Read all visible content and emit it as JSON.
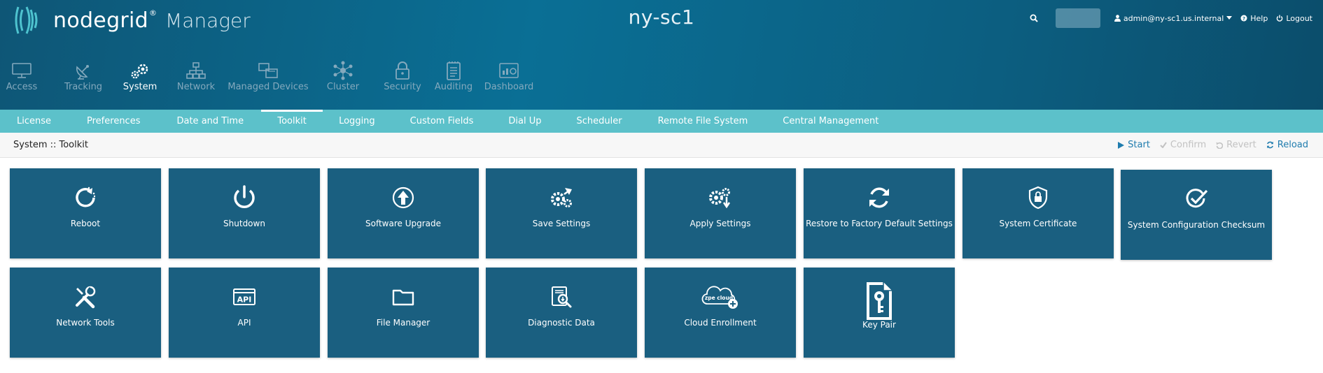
{
  "brand": {
    "name": "nodegrid",
    "reg": "®",
    "product": "Manager"
  },
  "hostname": "ny-sc1",
  "user": {
    "name": "admin@ny-sc1.us.internal",
    "help": "Help",
    "logout": "Logout"
  },
  "main_nav": [
    {
      "label": "Access",
      "icon": "monitor-icon"
    },
    {
      "label": "Tracking",
      "icon": "satellite-dish-icon"
    },
    {
      "label": "System",
      "icon": "gears-icon",
      "active": true
    },
    {
      "label": "Network",
      "icon": "network-icon"
    },
    {
      "label": "Managed Devices",
      "icon": "managed-devices-icon"
    },
    {
      "label": "Cluster",
      "icon": "cluster-icon"
    },
    {
      "label": "Security",
      "icon": "lock-icon"
    },
    {
      "label": "Auditing",
      "icon": "clipboard-icon"
    },
    {
      "label": "Dashboard",
      "icon": "dashboard-icon"
    }
  ],
  "sub_nav": [
    {
      "label": "License"
    },
    {
      "label": "Preferences"
    },
    {
      "label": "Date and Time"
    },
    {
      "label": "Toolkit",
      "active": true
    },
    {
      "label": "Logging"
    },
    {
      "label": "Custom Fields"
    },
    {
      "label": "Dial Up"
    },
    {
      "label": "Scheduler"
    },
    {
      "label": "Remote File System"
    },
    {
      "label": "Central Management"
    }
  ],
  "breadcrumb": "System :: Toolkit",
  "actions": [
    {
      "label": "Start",
      "icon": "play-icon",
      "enabled": true
    },
    {
      "label": "Confirm",
      "icon": "check-icon",
      "enabled": false
    },
    {
      "label": "Revert",
      "icon": "undo-icon",
      "enabled": false
    },
    {
      "label": "Reload",
      "icon": "refresh-icon",
      "enabled": true
    }
  ],
  "tiles": [
    {
      "label": "Reboot",
      "icon": "reboot-icon"
    },
    {
      "label": "Shutdown",
      "icon": "power-icon"
    },
    {
      "label": "Software Upgrade",
      "icon": "upgrade-arrow-icon"
    },
    {
      "label": "Save Settings",
      "icon": "save-gears-icon"
    },
    {
      "label": "Apply Settings",
      "icon": "apply-gears-icon"
    },
    {
      "label": "Restore to Factory Default Settings",
      "icon": "restore-icon"
    },
    {
      "label": "System Certificate",
      "icon": "shield-lock-icon"
    },
    {
      "label": "System Configuration Checksum",
      "icon": "checksum-icon"
    },
    {
      "label": "Network Tools",
      "icon": "tools-icon"
    },
    {
      "label": "API",
      "icon": "api-icon"
    },
    {
      "label": "File Manager",
      "icon": "folder-icon"
    },
    {
      "label": "Diagnostic Data",
      "icon": "diagnostic-icon"
    },
    {
      "label": "Cloud Enrollment",
      "icon": "cloud-enroll-icon"
    },
    {
      "label": "Key Pair",
      "icon": "key-icon"
    }
  ],
  "cloud_icon_text": "zpe cloud"
}
